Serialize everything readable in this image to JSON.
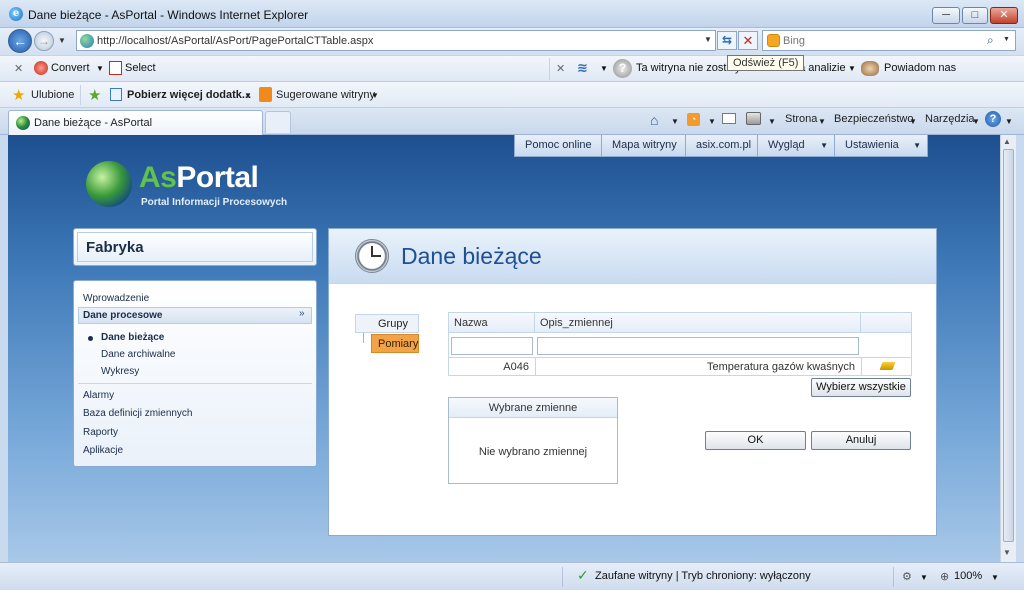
{
  "window": {
    "title": "Dane bieżące - AsPortal - Windows Internet Explorer",
    "minimize": "─",
    "maximize": "□",
    "close": "✕"
  },
  "address": {
    "url": "http://localhost/AsPortal/AsPort/PagePortalCTTable.aspx",
    "search_placeholder": "Bing",
    "refresh_tooltip": "Odśwież (F5)"
  },
  "toolbar": {
    "convert": "Convert",
    "select": "Select",
    "site_info": "Ta witryna nie zostały",
    "site_analysis": "na analizie",
    "notify": "Powiadom nas"
  },
  "favorites": {
    "label": "Ulubione",
    "more_addons": "Pobierz więcej dodatk...",
    "suggested": "Sugerowane witryny"
  },
  "tab": {
    "title": "Dane bieżące - AsPortal"
  },
  "commandbar": {
    "page": "Strona",
    "safety": "Bezpieczeństwo",
    "tools": "Narzędzia"
  },
  "portal": {
    "topnav": [
      "Pomoc online",
      "Mapa witryny",
      "asix.com.pl",
      "Wygląd",
      "Ustawienia"
    ],
    "logo_as": "As",
    "logo_portal": "Portal",
    "logo_sub": "Portal Informacji Procesowych",
    "site": "Fabryka",
    "menu": {
      "intro": "Wprowadzenie",
      "process_data": "Dane procesowe",
      "current": "Dane bieżące",
      "archive": "Dane archiwalne",
      "charts": "Wykresy",
      "alarms": "Alarmy",
      "vardb": "Baza definicji zmiennych",
      "reports": "Raporty",
      "apps": "Aplikacje"
    },
    "page_title": "Dane bieżące",
    "groups_tab": "Grupy",
    "measurements_tab": "Pomiary",
    "table": {
      "col_name": "Nazwa",
      "col_desc": "Opis_zmiennej",
      "rows": [
        {
          "name": "A046",
          "desc": "Temperatura gazów kwaśnych"
        }
      ]
    },
    "select_all": "Wybierz wszystkie",
    "selected_header": "Wybrane zmienne",
    "selected_empty": "Nie wybrano zmiennej",
    "ok": "OK",
    "cancel": "Anuluj"
  },
  "status": {
    "trusted": "Zaufane witryny | Tryb chroniony: wyłączony",
    "zoom": "100%"
  }
}
